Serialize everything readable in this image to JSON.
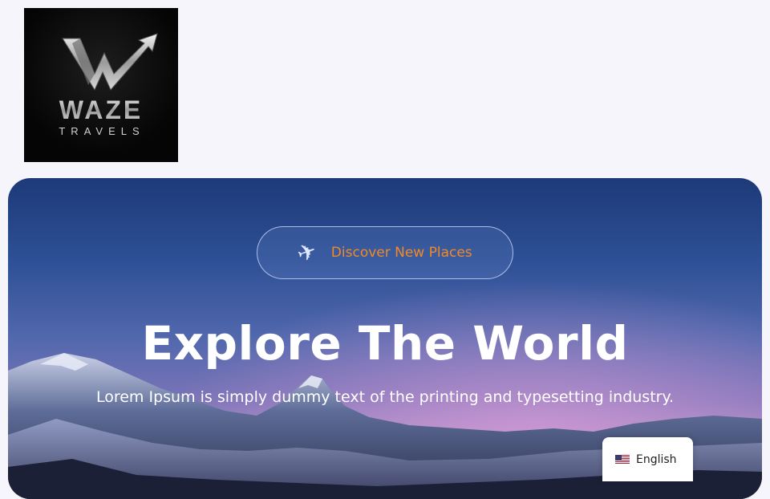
{
  "logo": {
    "brand": "WAZE",
    "sub": "TRAVELS"
  },
  "hero": {
    "badge_icon": "airplane-icon",
    "badge_label": "Discover New Places",
    "title": "Explore The World",
    "subtitle": "Lorem Ipsum is simply dummy text of the printing and typesetting industry."
  },
  "language": {
    "flag_icon": "us-flag-icon",
    "label": "English"
  },
  "colors": {
    "accent": "#f08a24",
    "page_bg": "#f7f5fc"
  }
}
